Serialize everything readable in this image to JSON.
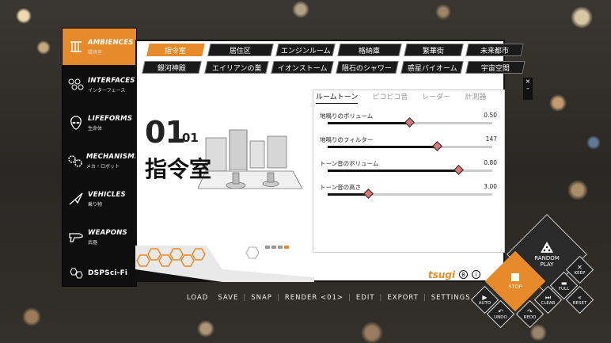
{
  "sidebar": {
    "items": [
      {
        "label": "AMBIENCES",
        "sub": "環境音",
        "icon": "pillars-icon"
      },
      {
        "label": "INTERFACES",
        "sub": "インターフェース",
        "icon": "nodes-icon"
      },
      {
        "label": "LIFEFORMS",
        "sub": "生命体",
        "icon": "alien-icon"
      },
      {
        "label": "MECHANISMS",
        "sub": "メカ・ロボット",
        "icon": "gears-icon"
      },
      {
        "label": "VEHICLES",
        "sub": "乗り物",
        "icon": "spaceship-icon"
      },
      {
        "label": "WEAPONS",
        "sub": "武器",
        "icon": "raygun-icon"
      },
      {
        "label": "DSPSci-Fi",
        "sub": "",
        "icon": "hexagons-icon"
      }
    ]
  },
  "scene_tabs": {
    "row1": [
      "指令室",
      "居住区",
      "エンジンルーム",
      "格納庫",
      "繁華街",
      "未来都市"
    ],
    "row2": [
      "銀河神殿",
      "エイリアンの巣",
      "イオンストーム",
      "隕石のシャワー",
      "惑星バイオーム",
      "宇宙空間"
    ]
  },
  "scene": {
    "number": "01",
    "sub_number": "01",
    "title": "指令室"
  },
  "param_tabs": [
    "ルームトーン",
    "ピコピコ音",
    "レーダー",
    "計測器"
  ],
  "params": [
    {
      "label": "地鳴りのボリューム",
      "value": "0.50",
      "level": 0.5
    },
    {
      "label": "地鳴りのフィルター",
      "value": "147",
      "level": 0.67
    },
    {
      "label": "トーン音のボリューム",
      "value": "0.80",
      "level": 0.8
    },
    {
      "label": "トーン音の高さ",
      "value": "3.00",
      "level": 0.25
    }
  ],
  "brand": {
    "name": "tsugi",
    "badge_b": "B",
    "badge_i": "i"
  },
  "menubar": [
    "LOAD",
    "SAVE",
    "SNAP",
    "RENDER <01>",
    "EDIT",
    "EXPORT",
    "SETTINGS"
  ],
  "controls": {
    "random_play": "RANDOM PLAY",
    "stop": "STOP",
    "keep": "KEEP",
    "full": "FULL",
    "reset": "RESET",
    "clear": "CLEAR",
    "auto": "AUTO",
    "undo": "UNDO",
    "redo": "REDO"
  },
  "window": {
    "close": "×",
    "minimize": "–"
  },
  "colors": {
    "accent": "#e78a2a",
    "thumb": "#d9767a",
    "dark": "#111111"
  }
}
